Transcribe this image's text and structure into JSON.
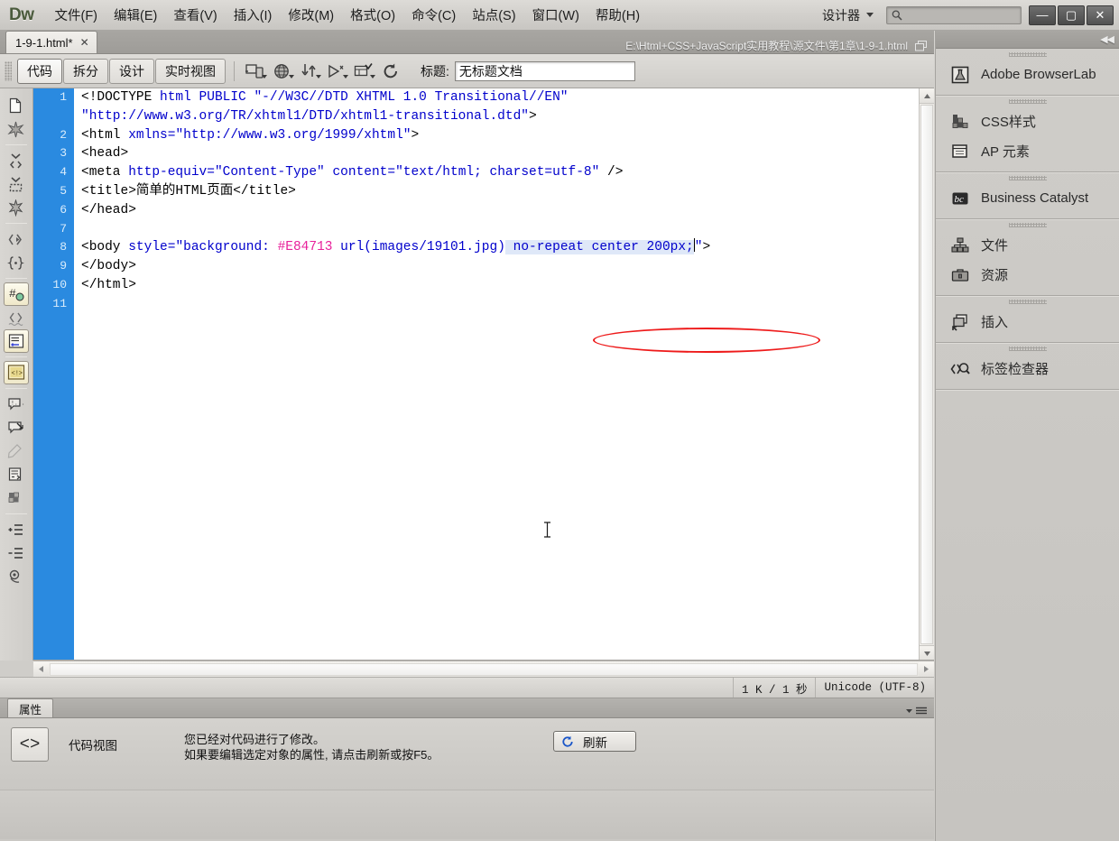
{
  "app": {
    "logo": "Dw",
    "workspace": "设计器",
    "search_placeholder": ""
  },
  "menubar": {
    "items": [
      {
        "label": "文件(F)",
        "name": "menu-file"
      },
      {
        "label": "编辑(E)",
        "name": "menu-edit"
      },
      {
        "label": "查看(V)",
        "name": "menu-view"
      },
      {
        "label": "插入(I)",
        "name": "menu-insert"
      },
      {
        "label": "修改(M)",
        "name": "menu-modify"
      },
      {
        "label": "格式(O)",
        "name": "menu-format"
      },
      {
        "label": "命令(C)",
        "name": "menu-commands"
      },
      {
        "label": "站点(S)",
        "name": "menu-site"
      },
      {
        "label": "窗口(W)",
        "name": "menu-window"
      },
      {
        "label": "帮助(H)",
        "name": "menu-help"
      }
    ]
  },
  "window_controls": {
    "minimize": "—",
    "maximize": "▢",
    "close": "✕"
  },
  "document_tab": {
    "title": "1-9-1.html*",
    "close": "✕",
    "file_path": "E:\\Html+CSS+JavaScript实用教程\\源文件\\第1章\\1-9-1.html"
  },
  "doc_toolbar": {
    "views": [
      {
        "label": "代码",
        "name": "view-code",
        "active": true
      },
      {
        "label": "拆分",
        "name": "view-split",
        "active": false
      },
      {
        "label": "设计",
        "name": "view-design",
        "active": false
      },
      {
        "label": "实时视图",
        "name": "view-live",
        "active": false
      }
    ],
    "title_label": "标题:",
    "title_value": "无标题文档"
  },
  "code": {
    "line_numbers": [
      "1",
      "2",
      "3",
      "4",
      "5",
      "6",
      "7",
      "8",
      "9",
      "10",
      "11"
    ],
    "lines": [
      "<!DOCTYPE html PUBLIC \"-//W3C//DTD XHTML 1.0 Transitional//EN\"",
      "\"http://www.w3.org/TR/xhtml1/DTD/xhtml1-transitional.dtd\">",
      "<html xmlns=\"http://www.w3.org/1999/xhtml\">",
      "<head>",
      "<meta http-equiv=\"Content-Type\" content=\"text/html; charset=utf-8\" />",
      "<title>简单的HTML页面</title>",
      "</head>",
      "",
      "<body style=\"background: #E84713 url(images/19101.jpg) no-repeat center 200px;\">",
      "</body>",
      "</html>",
      ""
    ],
    "highlight_text": "no-repeat center 200px;\">",
    "hex_color": "#E84713"
  },
  "status": {
    "size_time": "1 K / 1 秒",
    "encoding": "Unicode (UTF-8)"
  },
  "properties": {
    "tab_label": "属性",
    "view_label": "代码视图",
    "icon_glyph": "<>",
    "message_line1": "您已经对代码进行了修改。",
    "message_line2": "如果要编辑选定对象的属性, 请点击刷新或按F5。",
    "refresh_label": "刷新"
  },
  "dock": {
    "collapse": "◀◀",
    "groups": [
      {
        "items": [
          {
            "label": "Adobe BrowserLab",
            "icon": "browserlab-icon",
            "name": "dock-item-browserlab"
          }
        ]
      },
      {
        "items": [
          {
            "label": "CSS样式",
            "icon": "css-styles-icon",
            "name": "dock-item-css-styles"
          },
          {
            "label": "AP 元素",
            "icon": "ap-elements-icon",
            "name": "dock-item-ap-elements"
          }
        ]
      },
      {
        "items": [
          {
            "label": "Business Catalyst",
            "icon": "business-catalyst-icon",
            "name": "dock-item-business-catalyst"
          }
        ]
      },
      {
        "items": [
          {
            "label": "文件",
            "icon": "files-icon",
            "name": "dock-item-files"
          },
          {
            "label": "资源",
            "icon": "assets-icon",
            "name": "dock-item-assets"
          }
        ]
      },
      {
        "items": [
          {
            "label": "插入",
            "icon": "insert-icon",
            "name": "dock-item-insert"
          }
        ]
      },
      {
        "items": [
          {
            "label": "标签检查器",
            "icon": "tag-inspector-icon",
            "name": "dock-item-tag-inspector"
          }
        ]
      }
    ]
  },
  "colors": {
    "gutter_blue": "#2a8ae0",
    "code_blue": "#0000c8",
    "hex_pink": "#e8219b",
    "annotation_red": "#ee1b1b",
    "chrome_gray": "#cfcdc9"
  }
}
